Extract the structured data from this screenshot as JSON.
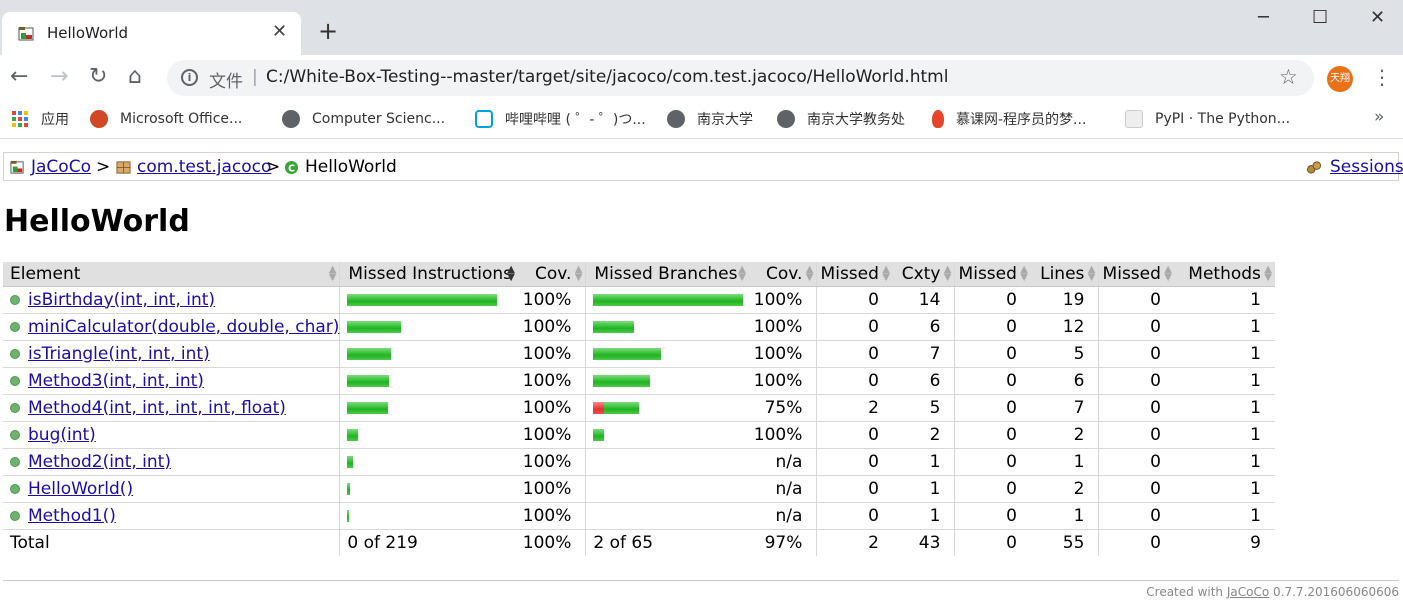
{
  "browser": {
    "tab": {
      "title": "HelloWorld",
      "close": "✕"
    },
    "new_tab": "+",
    "window": {
      "minimize": "─",
      "maximize": "☐",
      "close": "✕"
    },
    "nav": {
      "back": "←",
      "forward": "→",
      "reload": "↻",
      "home": "⌂"
    },
    "address": {
      "info": "i",
      "label": "文件",
      "separator": "|",
      "url": "C:/White-Box-Testing--master/target/site/jacoco/com.test.jacoco/HelloWorld.html"
    },
    "star": "☆",
    "profile": "天翔",
    "menu": "⋮",
    "bookmarks": [
      {
        "label": "应用",
        "icon": "apps-grid-icon",
        "color": "#4285f4"
      },
      {
        "label": "Microsoft Office...",
        "icon": "powerpoint-icon",
        "color": "#d24726"
      },
      {
        "label": "Computer Scienc...",
        "icon": "globe-icon",
        "color": "#5f6368"
      },
      {
        "label": "哔哩哔哩 ( ゜- ゜)つ...",
        "icon": "bilibili-icon",
        "color": "#00a1d6"
      },
      {
        "label": "南京大学",
        "icon": "globe-icon",
        "color": "#5f6368"
      },
      {
        "label": "南京大学教务处",
        "icon": "globe-icon",
        "color": "#5f6368"
      },
      {
        "label": "慕课网-程序员的梦...",
        "icon": "flame-icon",
        "color": "#e8452c"
      },
      {
        "label": "PyPI · The Python...",
        "icon": "package-icon",
        "color": "#cccccc"
      }
    ],
    "bookmarks_more": "»"
  },
  "breadcrumb": {
    "root": "JaCoCo",
    "sep1": ">",
    "package": "com.test.jacoco",
    "sep2": ">",
    "current": "HelloWorld",
    "sessions": "Sessions"
  },
  "page_title": "HelloWorld",
  "table": {
    "headers": [
      "Element",
      "Missed Instructions",
      "Cov.",
      "Missed Branches",
      "Cov.",
      "Missed",
      "Cxty",
      "Missed",
      "Lines",
      "Missed",
      "Methods"
    ],
    "rows": [
      {
        "name": "isBirthday(int, int, int)",
        "instr_bar": 1.0,
        "instr_cov": "100%",
        "branch_green": 1.0,
        "branch_red": 0,
        "branch_cov": "100%",
        "missed_cxty": "0",
        "cxty": "14",
        "missed_lines": "0",
        "lines": "19",
        "missed_methods": "0",
        "methods": "1"
      },
      {
        "name": "miniCalculator(double, double, char)",
        "instr_bar": 0.36,
        "instr_cov": "100%",
        "branch_green": 0.27,
        "branch_red": 0,
        "branch_cov": "100%",
        "missed_cxty": "0",
        "cxty": "6",
        "missed_lines": "0",
        "lines": "12",
        "missed_methods": "0",
        "methods": "1"
      },
      {
        "name": "isTriangle(int, int, int)",
        "instr_bar": 0.29,
        "instr_cov": "100%",
        "branch_green": 0.45,
        "branch_red": 0,
        "branch_cov": "100%",
        "missed_cxty": "0",
        "cxty": "7",
        "missed_lines": "0",
        "lines": "5",
        "missed_methods": "0",
        "methods": "1"
      },
      {
        "name": "Method3(int, int, int)",
        "instr_bar": 0.28,
        "instr_cov": "100%",
        "branch_green": 0.38,
        "branch_red": 0,
        "branch_cov": "100%",
        "missed_cxty": "0",
        "cxty": "6",
        "missed_lines": "0",
        "lines": "6",
        "missed_methods": "0",
        "methods": "1"
      },
      {
        "name": "Method4(int, int, int, int, float)",
        "instr_bar": 0.27,
        "instr_cov": "100%",
        "branch_green": 0.23,
        "branch_red": 0.07,
        "branch_cov": "75%",
        "missed_cxty": "2",
        "cxty": "5",
        "missed_lines": "0",
        "lines": "7",
        "missed_methods": "0",
        "methods": "1"
      },
      {
        "name": "bug(int)",
        "instr_bar": 0.07,
        "instr_cov": "100%",
        "branch_green": 0.07,
        "branch_red": 0,
        "branch_cov": "100%",
        "missed_cxty": "0",
        "cxty": "2",
        "missed_lines": "0",
        "lines": "2",
        "missed_methods": "0",
        "methods": "1"
      },
      {
        "name": "Method2(int, int)",
        "instr_bar": 0.04,
        "instr_cov": "100%",
        "branch_green": 0,
        "branch_red": 0,
        "branch_cov": "n/a",
        "missed_cxty": "0",
        "cxty": "1",
        "missed_lines": "0",
        "lines": "1",
        "missed_methods": "0",
        "methods": "1"
      },
      {
        "name": "HelloWorld()",
        "instr_bar": 0.02,
        "instr_cov": "100%",
        "branch_green": 0,
        "branch_red": 0,
        "branch_cov": "n/a",
        "missed_cxty": "0",
        "cxty": "1",
        "missed_lines": "0",
        "lines": "2",
        "missed_methods": "0",
        "methods": "1"
      },
      {
        "name": "Method1()",
        "instr_bar": 0.015,
        "instr_cov": "100%",
        "branch_green": 0,
        "branch_red": 0,
        "branch_cov": "n/a",
        "missed_cxty": "0",
        "cxty": "1",
        "missed_lines": "0",
        "lines": "1",
        "missed_methods": "0",
        "methods": "1"
      }
    ],
    "total": {
      "label": "Total",
      "instr": "0 of 219",
      "instr_cov": "100%",
      "branch": "2 of 65",
      "branch_cov": "97%",
      "missed_cxty": "2",
      "cxty": "43",
      "missed_lines": "0",
      "lines": "55",
      "missed_methods": "0",
      "methods": "9"
    }
  },
  "footer": {
    "prefix": "Created with",
    "link": "JaCoCo",
    "version": "0.7.7.201606060606"
  }
}
